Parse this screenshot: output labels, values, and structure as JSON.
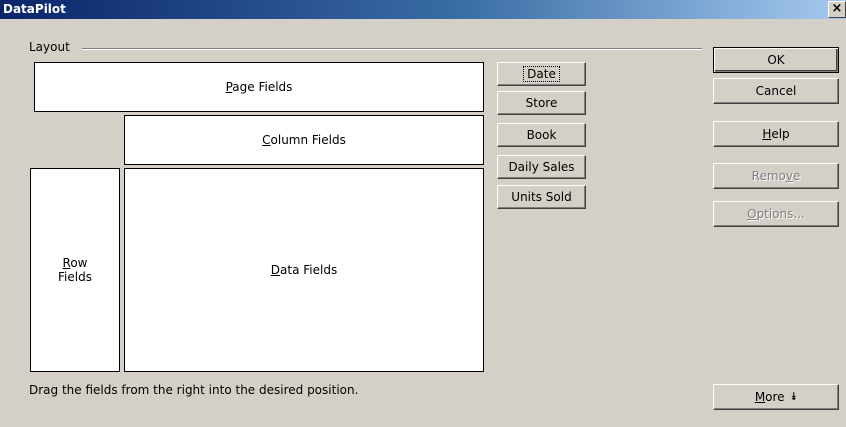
{
  "window": {
    "title": "DataPilot",
    "close_glyph": "×"
  },
  "layout": {
    "group_label": "Layout",
    "page_fields": {
      "mnemonic": "P",
      "rest": "age Fields"
    },
    "column_fields": {
      "mnemonic": "C",
      "rest": "olumn Fields"
    },
    "row_fields": {
      "mnemonic": "R",
      "line1_rest": "ow",
      "line2": "Fields"
    },
    "data_fields": {
      "mnemonic": "D",
      "rest": "ata Fields"
    },
    "hint": "Drag the fields from the right into the desired position."
  },
  "available_fields": [
    {
      "label": "Date"
    },
    {
      "label": "Store"
    },
    {
      "label": "Book"
    },
    {
      "label": "Daily Sales"
    },
    {
      "label": "Units Sold"
    }
  ],
  "buttons": {
    "ok": {
      "label": "OK"
    },
    "cancel": {
      "label": "Cancel"
    },
    "help": {
      "mnemonic": "H",
      "rest": "elp"
    },
    "remove": {
      "pre": "Remo",
      "mnemonic": "v",
      "post": "e"
    },
    "options": {
      "mnemonic": "O",
      "rest": "ptions..."
    },
    "more": {
      "mnemonic": "M",
      "rest": "ore",
      "icon": "double-chevron-down-icon",
      "glyph": "⯯"
    }
  }
}
